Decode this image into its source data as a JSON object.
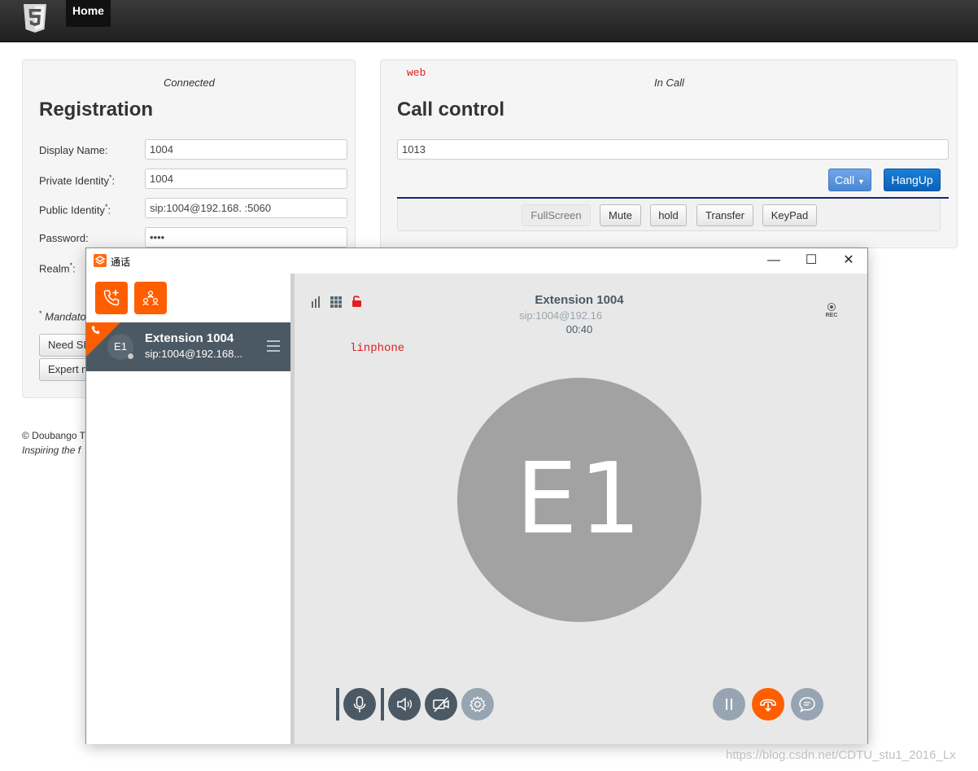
{
  "navbar": {
    "home_label": "Home"
  },
  "registration": {
    "status": "Connected",
    "title": "Registration",
    "fields": [
      {
        "label": "Display Name:",
        "required": false,
        "value": "1004"
      },
      {
        "label": "Private Identity",
        "required": true,
        "value": "1004"
      },
      {
        "label": "Public Identity",
        "required": true,
        "value": "sip:1004@192.168.      :5060"
      },
      {
        "label": "Password:",
        "required": false,
        "value": "••••"
      },
      {
        "label": "Realm",
        "required": true,
        "value": ""
      }
    ],
    "mandatory_note": " Mandato",
    "buttons": {
      "need_sip": "Need SI",
      "expert": "Expert m"
    }
  },
  "call_control": {
    "annotation": "web",
    "status": "In Call",
    "title": "Call control",
    "dial_value": "1013",
    "call_label": "Call",
    "hangup_label": "HangUp",
    "toolbar": {
      "fullscreen": "FullScreen",
      "mute": "Mute",
      "hold": "hold",
      "transfer": "Transfer",
      "keypad": "KeyPad"
    }
  },
  "footer": {
    "copyright": "© Doubango T",
    "tagline": "Inspiring the f"
  },
  "linphone": {
    "window_title": "通话",
    "contact": {
      "initials": "E1",
      "name": "Extension 1004",
      "address": "sip:1004@192.168..."
    },
    "call": {
      "name": "Extension 1004",
      "sip": "sip:1004@192.16",
      "duration": "00:40",
      "avatar_initials": "E1",
      "rec_label": "REC"
    },
    "annotation": "linphone",
    "colors": {
      "accent": "#fe5e00",
      "dark": "#4b5964",
      "muted": "#96a5b1"
    }
  },
  "watermark": "https://blog.csdn.net/CDTU_stu1_2016_Lx"
}
